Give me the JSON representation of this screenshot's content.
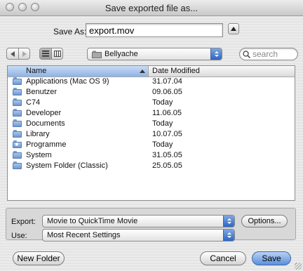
{
  "window": {
    "title": "Save exported file as..."
  },
  "save_as": {
    "label": "Save As:",
    "value": "export.mov"
  },
  "toolbar": {
    "location": "Bellyache",
    "search_placeholder": "search"
  },
  "browser": {
    "columns": {
      "name": "Name",
      "date": "Date Modified"
    },
    "items": [
      {
        "name": "Applications (Mac OS 9)",
        "date": "31.07.04",
        "icon": "folder-icon"
      },
      {
        "name": "Benutzer",
        "date": "09.06.05",
        "icon": "folder-icon"
      },
      {
        "name": "C74",
        "date": "Today",
        "icon": "folder-icon"
      },
      {
        "name": "Developer",
        "date": "11.06.05",
        "icon": "folder-icon"
      },
      {
        "name": "Documents",
        "date": "Today",
        "icon": "folder-icon"
      },
      {
        "name": "Library",
        "date": "10.07.05",
        "icon": "folder-icon"
      },
      {
        "name": "Programme",
        "date": "Today",
        "icon": "applications-folder-icon"
      },
      {
        "name": "System",
        "date": "31.05.05",
        "icon": "folder-icon"
      },
      {
        "name": "System Folder (Classic)",
        "date": "25.05.05",
        "icon": "folder-icon"
      }
    ]
  },
  "accessory": {
    "export_label": "Export:",
    "export_value": "Movie to QuickTime Movie",
    "options_label": "Options...",
    "use_label": "Use:",
    "use_value": "Most Recent Settings"
  },
  "buttons": {
    "new_folder": "New Folder",
    "cancel": "Cancel",
    "save": "Save"
  },
  "colors": {
    "accent": "#5c8fdb",
    "header_selected": "#8fb3e6"
  }
}
